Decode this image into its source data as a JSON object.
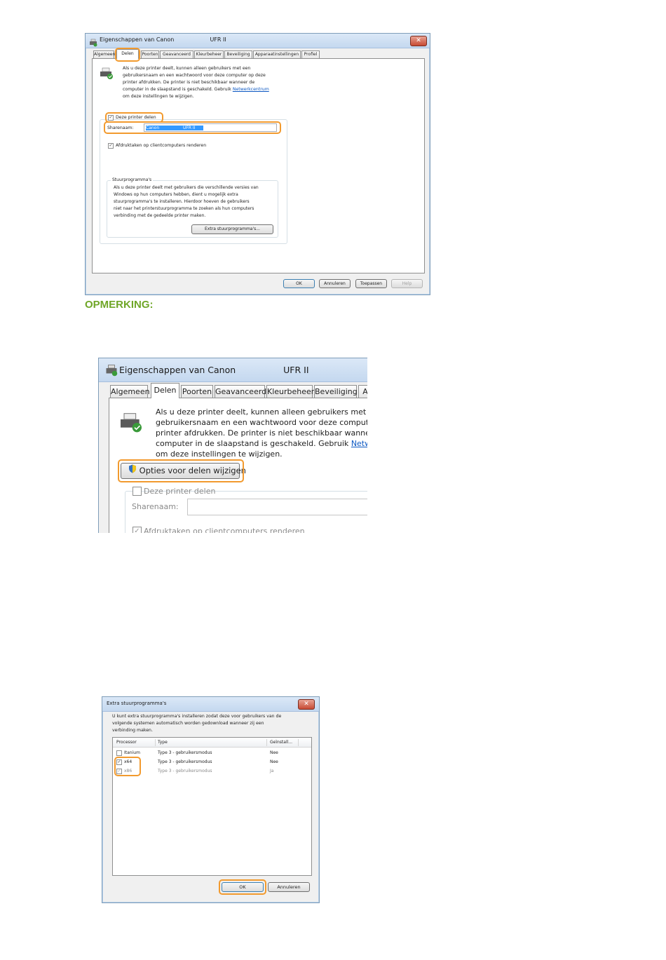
{
  "note_heading": "OPMERKING:",
  "dialog1": {
    "title_prefix": "Eigenschappen van Canon",
    "title_suffix": "UFR II",
    "tabs": [
      {
        "label": "Algemeen"
      },
      {
        "label": "Delen"
      },
      {
        "label": "Poorten"
      },
      {
        "label": "Geavanceerd"
      },
      {
        "label": "Kleurbeheer"
      },
      {
        "label": "Beveiliging"
      },
      {
        "label": "Apparaatinstellingen"
      },
      {
        "label": "Profiel"
      }
    ],
    "info_lines": [
      "Als u deze printer deelt, kunnen alleen gebruikers met een",
      "gebruikersnaam en een wachtwoord voor deze computer op deze",
      "printer afdrukken. De printer is niet beschikbaar wanneer de",
      "computer in de slaapstand is geschakeld. Gebruik"
    ],
    "link_text": "Netwerkcentrum",
    "info_last_line": "om deze instellingen te wijzigen.",
    "share_checkbox_label": "Deze printer delen",
    "share_name_label": "Sharenaam:",
    "share_name_value_prefix": "Canon",
    "share_name_value_suffix": "UFR II",
    "render_checkbox_label": "Afdruktaken op clientcomputers renderen",
    "drivers_group_title": "Stuurprogramma's",
    "drivers_lines": [
      "Als u deze printer deelt met gebruikers die verschillende versies van",
      "Windows op hun computers hebben, dient u mogelijk extra",
      "stuurprogramma's te installeren. Hierdoor hoeven de gebruikers",
      "niet naar het printerstuurprogramma te zoeken als hun computers",
      "verbinding met de gedeelde printer maken."
    ],
    "extra_drivers_button": "Extra stuurprogramma's...",
    "buttons": {
      "ok": "OK",
      "cancel": "Annuleren",
      "apply": "Toepassen",
      "help": "Help"
    }
  },
  "dialog2": {
    "title_prefix": "Eigenschappen van Canon",
    "title_suffix": "UFR II",
    "tabs": [
      {
        "label": "Algemeen"
      },
      {
        "label": "Delen"
      },
      {
        "label": "Poorten"
      },
      {
        "label": "Geavanceerd"
      },
      {
        "label": "Kleurbeheer"
      },
      {
        "label": "Beveiliging"
      },
      {
        "label": "A"
      }
    ],
    "info_lines": [
      "Als u deze printer deelt, kunnen alleen gebruikers met een",
      "gebruikersnaam en een wachtwoord voor deze computer d",
      "printer afdrukken. De printer is niet beschikbaar wanneer d",
      "computer in de slaapstand is geschakeld. Gebruik"
    ],
    "link_text": "Netwerk",
    "info_last_line": "om deze instellingen te wijzigen.",
    "change_sharing_button": "Opties voor delen wijzigen",
    "share_checkbox_label": "Deze printer delen",
    "share_name_label": "Sharenaam:",
    "render_checkbox_label": "Afdruktaken op clientcomputers renderen"
  },
  "dialog3": {
    "title": "Extra stuurprogramma's",
    "description_lines": [
      "U kunt extra stuurprogramma's installeren zodat deze voor gebruikers van de",
      "volgende systemen automatisch worden gedownload wanneer zij een",
      "verbinding maken."
    ],
    "columns": {
      "processor": "Processor",
      "type": "Type",
      "installed": "Geïnstall..."
    },
    "rows": [
      {
        "processor": "Itanium",
        "type": "Type 3 - gebruikersmodus",
        "installed": "Nee",
        "checked": false
      },
      {
        "processor": "x64",
        "type": "Type 3 - gebruikersmodus",
        "installed": "Nee",
        "checked": true
      },
      {
        "processor": "x86",
        "type": "Type 3 - gebruikersmodus",
        "installed": "Ja",
        "checked": true
      }
    ],
    "buttons": {
      "ok": "OK",
      "cancel": "Annuleren"
    }
  },
  "icons": {
    "close": "close-icon",
    "printer": "printer-icon",
    "shield": "shield-icon",
    "check": "check-icon"
  },
  "colors": {
    "highlight": "#f29a2e",
    "note_green": "#6fa627",
    "link_blue": "#0b57c2"
  }
}
